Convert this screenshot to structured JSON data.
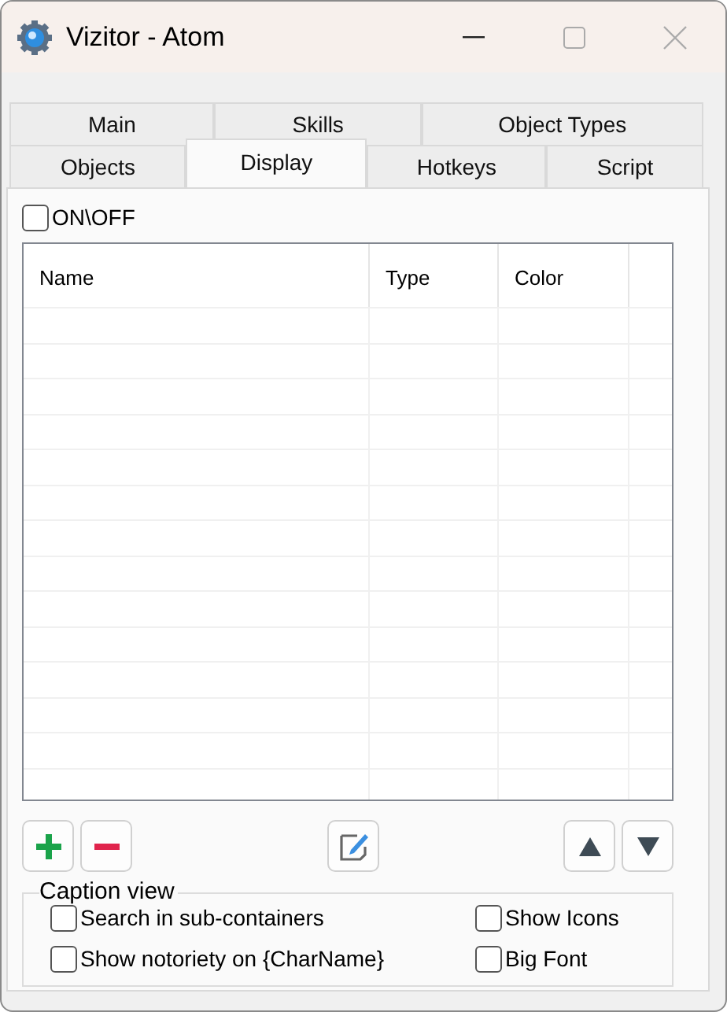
{
  "window": {
    "title": "Vizitor - Atom"
  },
  "tab_rows": [
    [
      {
        "label": "Main",
        "selected": false
      },
      {
        "label": "Skills",
        "selected": false
      },
      {
        "label": "Object Types",
        "selected": false
      }
    ],
    [
      {
        "label": "Objects",
        "selected": false
      },
      {
        "label": "Display",
        "selected": true
      },
      {
        "label": "Hotkeys",
        "selected": false
      },
      {
        "label": "Script",
        "selected": false
      }
    ]
  ],
  "on_off": {
    "label": "ON\\OFF",
    "checked": false
  },
  "table": {
    "columns": [
      "Name",
      "Type",
      "Color"
    ]
  },
  "caption_view": {
    "title": "Caption view",
    "options": [
      {
        "label": "Search in sub-containers",
        "checked": false
      },
      {
        "label": "Show Icons",
        "checked": false
      },
      {
        "label": "Show notoriety on {CharName}",
        "checked": false
      },
      {
        "label": "Big Font",
        "checked": false
      }
    ]
  }
}
